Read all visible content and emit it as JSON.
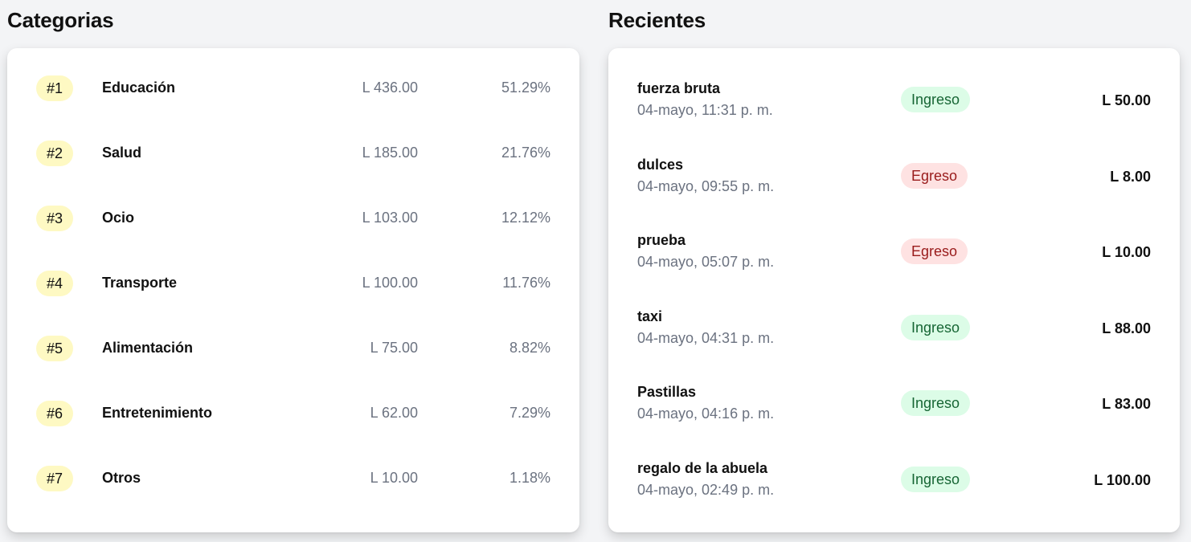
{
  "categories": {
    "title": "Categorias",
    "items": [
      {
        "rank": "#1",
        "name": "Educación",
        "amount": "L 436.00",
        "percent": "51.29%"
      },
      {
        "rank": "#2",
        "name": "Salud",
        "amount": "L 185.00",
        "percent": "21.76%"
      },
      {
        "rank": "#3",
        "name": "Ocio",
        "amount": "L 103.00",
        "percent": "12.12%"
      },
      {
        "rank": "#4",
        "name": "Transporte",
        "amount": "L 100.00",
        "percent": "11.76%"
      },
      {
        "rank": "#5",
        "name": "Alimentación",
        "amount": "L 75.00",
        "percent": "8.82%"
      },
      {
        "rank": "#6",
        "name": "Entretenimiento",
        "amount": "L 62.00",
        "percent": "7.29%"
      },
      {
        "rank": "#7",
        "name": "Otros",
        "amount": "L 10.00",
        "percent": "1.18%"
      }
    ]
  },
  "recent": {
    "title": "Recientes",
    "items": [
      {
        "name": "fuerza bruta",
        "date": "04-mayo, 11:31 p. m.",
        "type": "Ingreso",
        "amount": "L 50.00"
      },
      {
        "name": "dulces",
        "date": "04-mayo, 09:55 p. m.",
        "type": "Egreso",
        "amount": "L 8.00"
      },
      {
        "name": "prueba",
        "date": "04-mayo, 05:07 p. m.",
        "type": "Egreso",
        "amount": "L 10.00"
      },
      {
        "name": "taxi",
        "date": "04-mayo, 04:31 p. m.",
        "type": "Ingreso",
        "amount": "L 88.00"
      },
      {
        "name": "Pastillas",
        "date": "04-mayo, 04:16 p. m.",
        "type": "Ingreso",
        "amount": "L 83.00"
      },
      {
        "name": "regalo de la abuela",
        "date": "04-mayo, 02:49 p. m.",
        "type": "Ingreso",
        "amount": "L 100.00"
      }
    ]
  },
  "colors": {
    "background": "#f3f4f6",
    "card": "#ffffff",
    "rank_badge": "#fef9c3",
    "ingreso_bg": "#dcfce7",
    "ingreso_text": "#166534",
    "egreso_bg": "#fee2e2",
    "egreso_text": "#991b1b",
    "muted_text": "#6b7280"
  }
}
